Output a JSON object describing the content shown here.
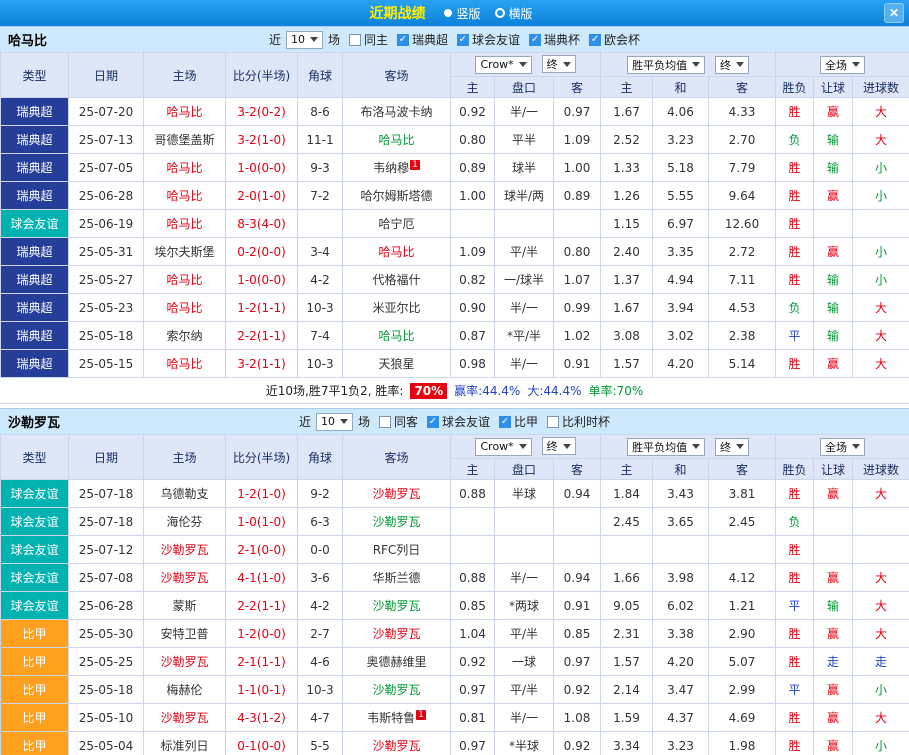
{
  "titlebar": {
    "title": "近期战绩",
    "radio_vertical": "竖版",
    "radio_horizontal": "横版",
    "close_icon": "✕"
  },
  "table_header": {
    "col_type": "类型",
    "col_date": "日期",
    "col_home": "主场",
    "col_score": "比分(半场)",
    "col_corner": "角球",
    "col_away": "客场",
    "dd_bookmaker": "Crow*",
    "dd_final": "终",
    "dd_avg": "胜平负均值",
    "dd_scope": "全场",
    "sub": [
      "主",
      "盘口",
      "客",
      "主",
      "和",
      "客",
      "胜负",
      "让球",
      "进球数"
    ]
  },
  "sections": [
    {
      "team": "哈马比",
      "filters": {
        "near": "近",
        "count": "10",
        "unit": "场",
        "checkboxes": [
          {
            "label": "同主",
            "checked": false
          },
          {
            "label": "瑞典超",
            "checked": true
          },
          {
            "label": "球会友谊",
            "checked": true
          },
          {
            "label": "瑞典杯",
            "checked": true
          },
          {
            "label": "欧会杯",
            "checked": true
          }
        ]
      },
      "rows": [
        {
          "lg": "瑞典超",
          "lc": "navy",
          "date": "25-07-20",
          "home": "哈马比",
          "hc": "red",
          "hsup": "",
          "score": "3-2(0-2)",
          "corner": "8-6",
          "away": "布洛马波卡纳",
          "ac": "black",
          "asup": "",
          "o": [
            "0.92",
            "半/一",
            "0.97",
            "1.67",
            "4.06",
            "4.33"
          ],
          "r": [
            "胜",
            "red"
          ],
          "h": [
            "赢",
            "red"
          ],
          "g": [
            "大",
            "red"
          ]
        },
        {
          "lg": "瑞典超",
          "lc": "navy",
          "date": "25-07-13",
          "home": "哥德堡盖斯",
          "hc": "black",
          "hsup": "",
          "score": "3-2(1-0)",
          "corner": "11-1",
          "away": "哈马比",
          "ac": "green",
          "asup": "",
          "o": [
            "0.80",
            "平半",
            "1.09",
            "2.52",
            "3.23",
            "2.70"
          ],
          "r": [
            "负",
            "green"
          ],
          "h": [
            "输",
            "green"
          ],
          "g": [
            "大",
            "red"
          ]
        },
        {
          "lg": "瑞典超",
          "lc": "navy",
          "date": "25-07-05",
          "home": "哈马比",
          "hc": "red",
          "hsup": "",
          "score": "1-0(0-0)",
          "corner": "9-3",
          "away": "韦纳穆",
          "ac": "black",
          "asup": "1",
          "o": [
            "0.89",
            "球半",
            "1.00",
            "1.33",
            "5.18",
            "7.79"
          ],
          "r": [
            "胜",
            "red"
          ],
          "h": [
            "输",
            "green"
          ],
          "g": [
            "小",
            "green"
          ]
        },
        {
          "lg": "瑞典超",
          "lc": "navy",
          "date": "25-06-28",
          "home": "哈马比",
          "hc": "red",
          "hsup": "",
          "score": "2-0(1-0)",
          "corner": "7-2",
          "away": "哈尔姆斯塔德",
          "ac": "black",
          "asup": "",
          "o": [
            "1.00",
            "球半/两",
            "0.89",
            "1.26",
            "5.55",
            "9.64"
          ],
          "r": [
            "胜",
            "red"
          ],
          "h": [
            "赢",
            "red"
          ],
          "g": [
            "小",
            "green"
          ]
        },
        {
          "lg": "球会友谊",
          "lc": "teal",
          "date": "25-06-19",
          "home": "哈马比",
          "hc": "red",
          "hsup": "",
          "score": "8-3(4-0)",
          "corner": "",
          "away": "哈宁厄",
          "ac": "black",
          "asup": "",
          "o": [
            "",
            "",
            "",
            "1.15",
            "6.97",
            "12.60"
          ],
          "r": [
            "胜",
            "red"
          ],
          "h": [
            "",
            ""
          ],
          "g": [
            "",
            ""
          ]
        },
        {
          "lg": "瑞典超",
          "lc": "navy",
          "date": "25-05-31",
          "home": "埃尔夫斯堡",
          "hc": "black",
          "hsup": "",
          "score": "0-2(0-0)",
          "corner": "3-4",
          "away": "哈马比",
          "ac": "red",
          "asup": "",
          "o": [
            "1.09",
            "平/半",
            "0.80",
            "2.40",
            "3.35",
            "2.72"
          ],
          "r": [
            "胜",
            "red"
          ],
          "h": [
            "赢",
            "red"
          ],
          "g": [
            "小",
            "green"
          ]
        },
        {
          "lg": "瑞典超",
          "lc": "navy",
          "date": "25-05-27",
          "home": "哈马比",
          "hc": "red",
          "hsup": "",
          "score": "1-0(0-0)",
          "corner": "4-2",
          "away": "代格福什",
          "ac": "black",
          "asup": "",
          "o": [
            "0.82",
            "一/球半",
            "1.07",
            "1.37",
            "4.94",
            "7.11"
          ],
          "r": [
            "胜",
            "red"
          ],
          "h": [
            "输",
            "green"
          ],
          "g": [
            "小",
            "green"
          ]
        },
        {
          "lg": "瑞典超",
          "lc": "navy",
          "date": "25-05-23",
          "home": "哈马比",
          "hc": "red",
          "hsup": "",
          "score": "1-2(1-1)",
          "corner": "10-3",
          "away": "米亚尔比",
          "ac": "black",
          "asup": "",
          "o": [
            "0.90",
            "半/一",
            "0.99",
            "1.67",
            "3.94",
            "4.53"
          ],
          "r": [
            "负",
            "green"
          ],
          "h": [
            "输",
            "green"
          ],
          "g": [
            "大",
            "red"
          ]
        },
        {
          "lg": "瑞典超",
          "lc": "navy",
          "date": "25-05-18",
          "home": "索尔纳",
          "hc": "black",
          "hsup": "",
          "score": "2-2(1-1)",
          "corner": "7-4",
          "away": "哈马比",
          "ac": "green",
          "asup": "",
          "o": [
            "0.87",
            "*平/半",
            "1.02",
            "3.08",
            "3.02",
            "2.38"
          ],
          "r": [
            "平",
            "blue"
          ],
          "h": [
            "输",
            "green"
          ],
          "g": [
            "大",
            "red"
          ]
        },
        {
          "lg": "瑞典超",
          "lc": "navy",
          "date": "25-05-15",
          "home": "哈马比",
          "hc": "red",
          "hsup": "",
          "score": "3-2(1-1)",
          "corner": "10-3",
          "away": "天狼星",
          "ac": "black",
          "asup": "",
          "o": [
            "0.98",
            "半/一",
            "0.91",
            "1.57",
            "4.20",
            "5.14"
          ],
          "r": [
            "胜",
            "red"
          ],
          "h": [
            "赢",
            "red"
          ],
          "g": [
            "大",
            "red"
          ]
        }
      ],
      "summary": {
        "text": "近10场,胜7平1负2, 胜率:",
        "win_rate": "70%",
        "asian_rate": "赢率:44.4%",
        "big_rate": "大:44.4%",
        "single_rate": "单率:70%"
      }
    },
    {
      "team": "沙勒罗瓦",
      "filters": {
        "near": "近",
        "count": "10",
        "unit": "场",
        "checkboxes": [
          {
            "label": "同客",
            "checked": false
          },
          {
            "label": "球会友谊",
            "checked": true
          },
          {
            "label": "比甲",
            "checked": true
          },
          {
            "label": "比利时杯",
            "checked": false
          }
        ]
      },
      "rows": [
        {
          "lg": "球会友谊",
          "lc": "teal",
          "date": "25-07-18",
          "home": "乌德勒支",
          "hc": "black",
          "hsup": "",
          "score": "1-2(1-0)",
          "corner": "9-2",
          "away": "沙勒罗瓦",
          "ac": "red",
          "asup": "",
          "o": [
            "0.88",
            "半球",
            "0.94",
            "1.84",
            "3.43",
            "3.81"
          ],
          "r": [
            "胜",
            "red"
          ],
          "h": [
            "赢",
            "red"
          ],
          "g": [
            "大",
            "red"
          ]
        },
        {
          "lg": "球会友谊",
          "lc": "teal",
          "date": "25-07-18",
          "home": "海伦芬",
          "hc": "black",
          "hsup": "",
          "score": "1-0(1-0)",
          "corner": "6-3",
          "away": "沙勒罗瓦",
          "ac": "green",
          "asup": "",
          "o": [
            "",
            "",
            "",
            "2.45",
            "3.65",
            "2.45"
          ],
          "r": [
            "负",
            "green"
          ],
          "h": [
            "",
            ""
          ],
          "g": [
            "",
            ""
          ]
        },
        {
          "lg": "球会友谊",
          "lc": "teal",
          "date": "25-07-12",
          "home": "沙勒罗瓦",
          "hc": "red",
          "hsup": "",
          "score": "2-1(0-0)",
          "corner": "0-0",
          "away": "RFC列日",
          "ac": "black",
          "asup": "",
          "o": [
            "",
            "",
            "",
            "",
            "",
            ""
          ],
          "r": [
            "胜",
            "red"
          ],
          "h": [
            "",
            ""
          ],
          "g": [
            "",
            ""
          ]
        },
        {
          "lg": "球会友谊",
          "lc": "teal",
          "date": "25-07-08",
          "home": "沙勒罗瓦",
          "hc": "red",
          "hsup": "",
          "score": "4-1(1-0)",
          "corner": "3-6",
          "away": "华斯兰德",
          "ac": "black",
          "asup": "",
          "o": [
            "0.88",
            "半/一",
            "0.94",
            "1.66",
            "3.98",
            "4.12"
          ],
          "r": [
            "胜",
            "red"
          ],
          "h": [
            "赢",
            "red"
          ],
          "g": [
            "大",
            "red"
          ]
        },
        {
          "lg": "球会友谊",
          "lc": "teal",
          "date": "25-06-28",
          "home": "蒙斯",
          "hc": "black",
          "hsup": "",
          "score": "2-2(1-1)",
          "corner": "4-2",
          "away": "沙勒罗瓦",
          "ac": "green",
          "asup": "",
          "o": [
            "0.85",
            "*两球",
            "0.91",
            "9.05",
            "6.02",
            "1.21"
          ],
          "r": [
            "平",
            "blue"
          ],
          "h": [
            "输",
            "green"
          ],
          "g": [
            "大",
            "red"
          ]
        },
        {
          "lg": "比甲",
          "lc": "orange",
          "date": "25-05-30",
          "home": "安特卫普",
          "hc": "black",
          "hsup": "",
          "score": "1-2(0-0)",
          "corner": "2-7",
          "away": "沙勒罗瓦",
          "ac": "red",
          "asup": "",
          "o": [
            "1.04",
            "平/半",
            "0.85",
            "2.31",
            "3.38",
            "2.90"
          ],
          "r": [
            "胜",
            "red"
          ],
          "h": [
            "赢",
            "red"
          ],
          "g": [
            "大",
            "red"
          ]
        },
        {
          "lg": "比甲",
          "lc": "orange",
          "date": "25-05-25",
          "home": "沙勒罗瓦",
          "hc": "red",
          "hsup": "",
          "score": "2-1(1-1)",
          "corner": "4-6",
          "away": "奥德赫维里",
          "ac": "black",
          "asup": "",
          "o": [
            "0.92",
            "一球",
            "0.97",
            "1.57",
            "4.20",
            "5.07"
          ],
          "r": [
            "胜",
            "red"
          ],
          "h": [
            "走",
            "blue"
          ],
          "g": [
            "走",
            "blue"
          ]
        },
        {
          "lg": "比甲",
          "lc": "orange",
          "date": "25-05-18",
          "home": "梅赫伦",
          "hc": "black",
          "hsup": "",
          "score": "1-1(0-1)",
          "corner": "10-3",
          "away": "沙勒罗瓦",
          "ac": "green",
          "asup": "",
          "o": [
            "0.97",
            "平/半",
            "0.92",
            "2.14",
            "3.47",
            "2.99"
          ],
          "r": [
            "平",
            "blue"
          ],
          "h": [
            "赢",
            "red"
          ],
          "g": [
            "小",
            "green"
          ]
        },
        {
          "lg": "比甲",
          "lc": "orange",
          "date": "25-05-10",
          "home": "沙勒罗瓦",
          "hc": "red",
          "hsup": "",
          "score": "4-3(1-2)",
          "corner": "4-7",
          "away": "韦斯特鲁",
          "ac": "black",
          "asup": "1",
          "o": [
            "0.81",
            "半/一",
            "1.08",
            "1.59",
            "4.37",
            "4.69"
          ],
          "r": [
            "胜",
            "red"
          ],
          "h": [
            "赢",
            "red"
          ],
          "g": [
            "大",
            "red"
          ]
        },
        {
          "lg": "比甲",
          "lc": "orange",
          "date": "25-05-04",
          "home": "标准列日",
          "hc": "black",
          "hsup": "",
          "score": "0-1(0-0)",
          "corner": "5-5",
          "away": "沙勒罗瓦",
          "ac": "red",
          "asup": "",
          "o": [
            "0.97",
            "*半球",
            "0.92",
            "3.34",
            "3.23",
            "1.98"
          ],
          "r": [
            "胜",
            "red"
          ],
          "h": [
            "赢",
            "red"
          ],
          "g": [
            "小",
            "green"
          ]
        }
      ]
    }
  ]
}
